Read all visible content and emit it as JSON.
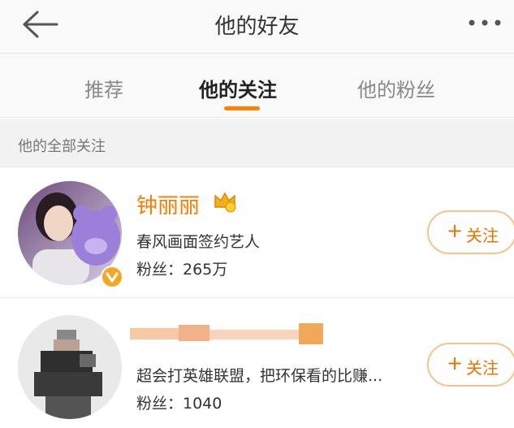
{
  "header": {
    "title": "他的好友",
    "back_icon": "arrow-left-icon",
    "more_icon": "more-dots-icon"
  },
  "tabs": [
    {
      "label": "推荐",
      "active": false
    },
    {
      "label": "他的关注",
      "active": true
    },
    {
      "label": "他的粉丝",
      "active": false
    }
  ],
  "accent_color": "#ff8200",
  "section": {
    "title": "他的全部关注"
  },
  "users": [
    {
      "name": "钟丽丽",
      "desc": "春风画面签约艺人",
      "fans": "粉丝：265万",
      "follow_label": "关注",
      "follow_icon": "plus-icon",
      "badge_icon": "crown-vip-icon",
      "verified_icon": "verified-v-icon"
    },
    {
      "name": "",
      "desc": "超会打英雄联盟，把环保看的比赚...",
      "fans": "粉丝：1040",
      "follow_label": "关注",
      "follow_icon": "plus-icon"
    }
  ]
}
